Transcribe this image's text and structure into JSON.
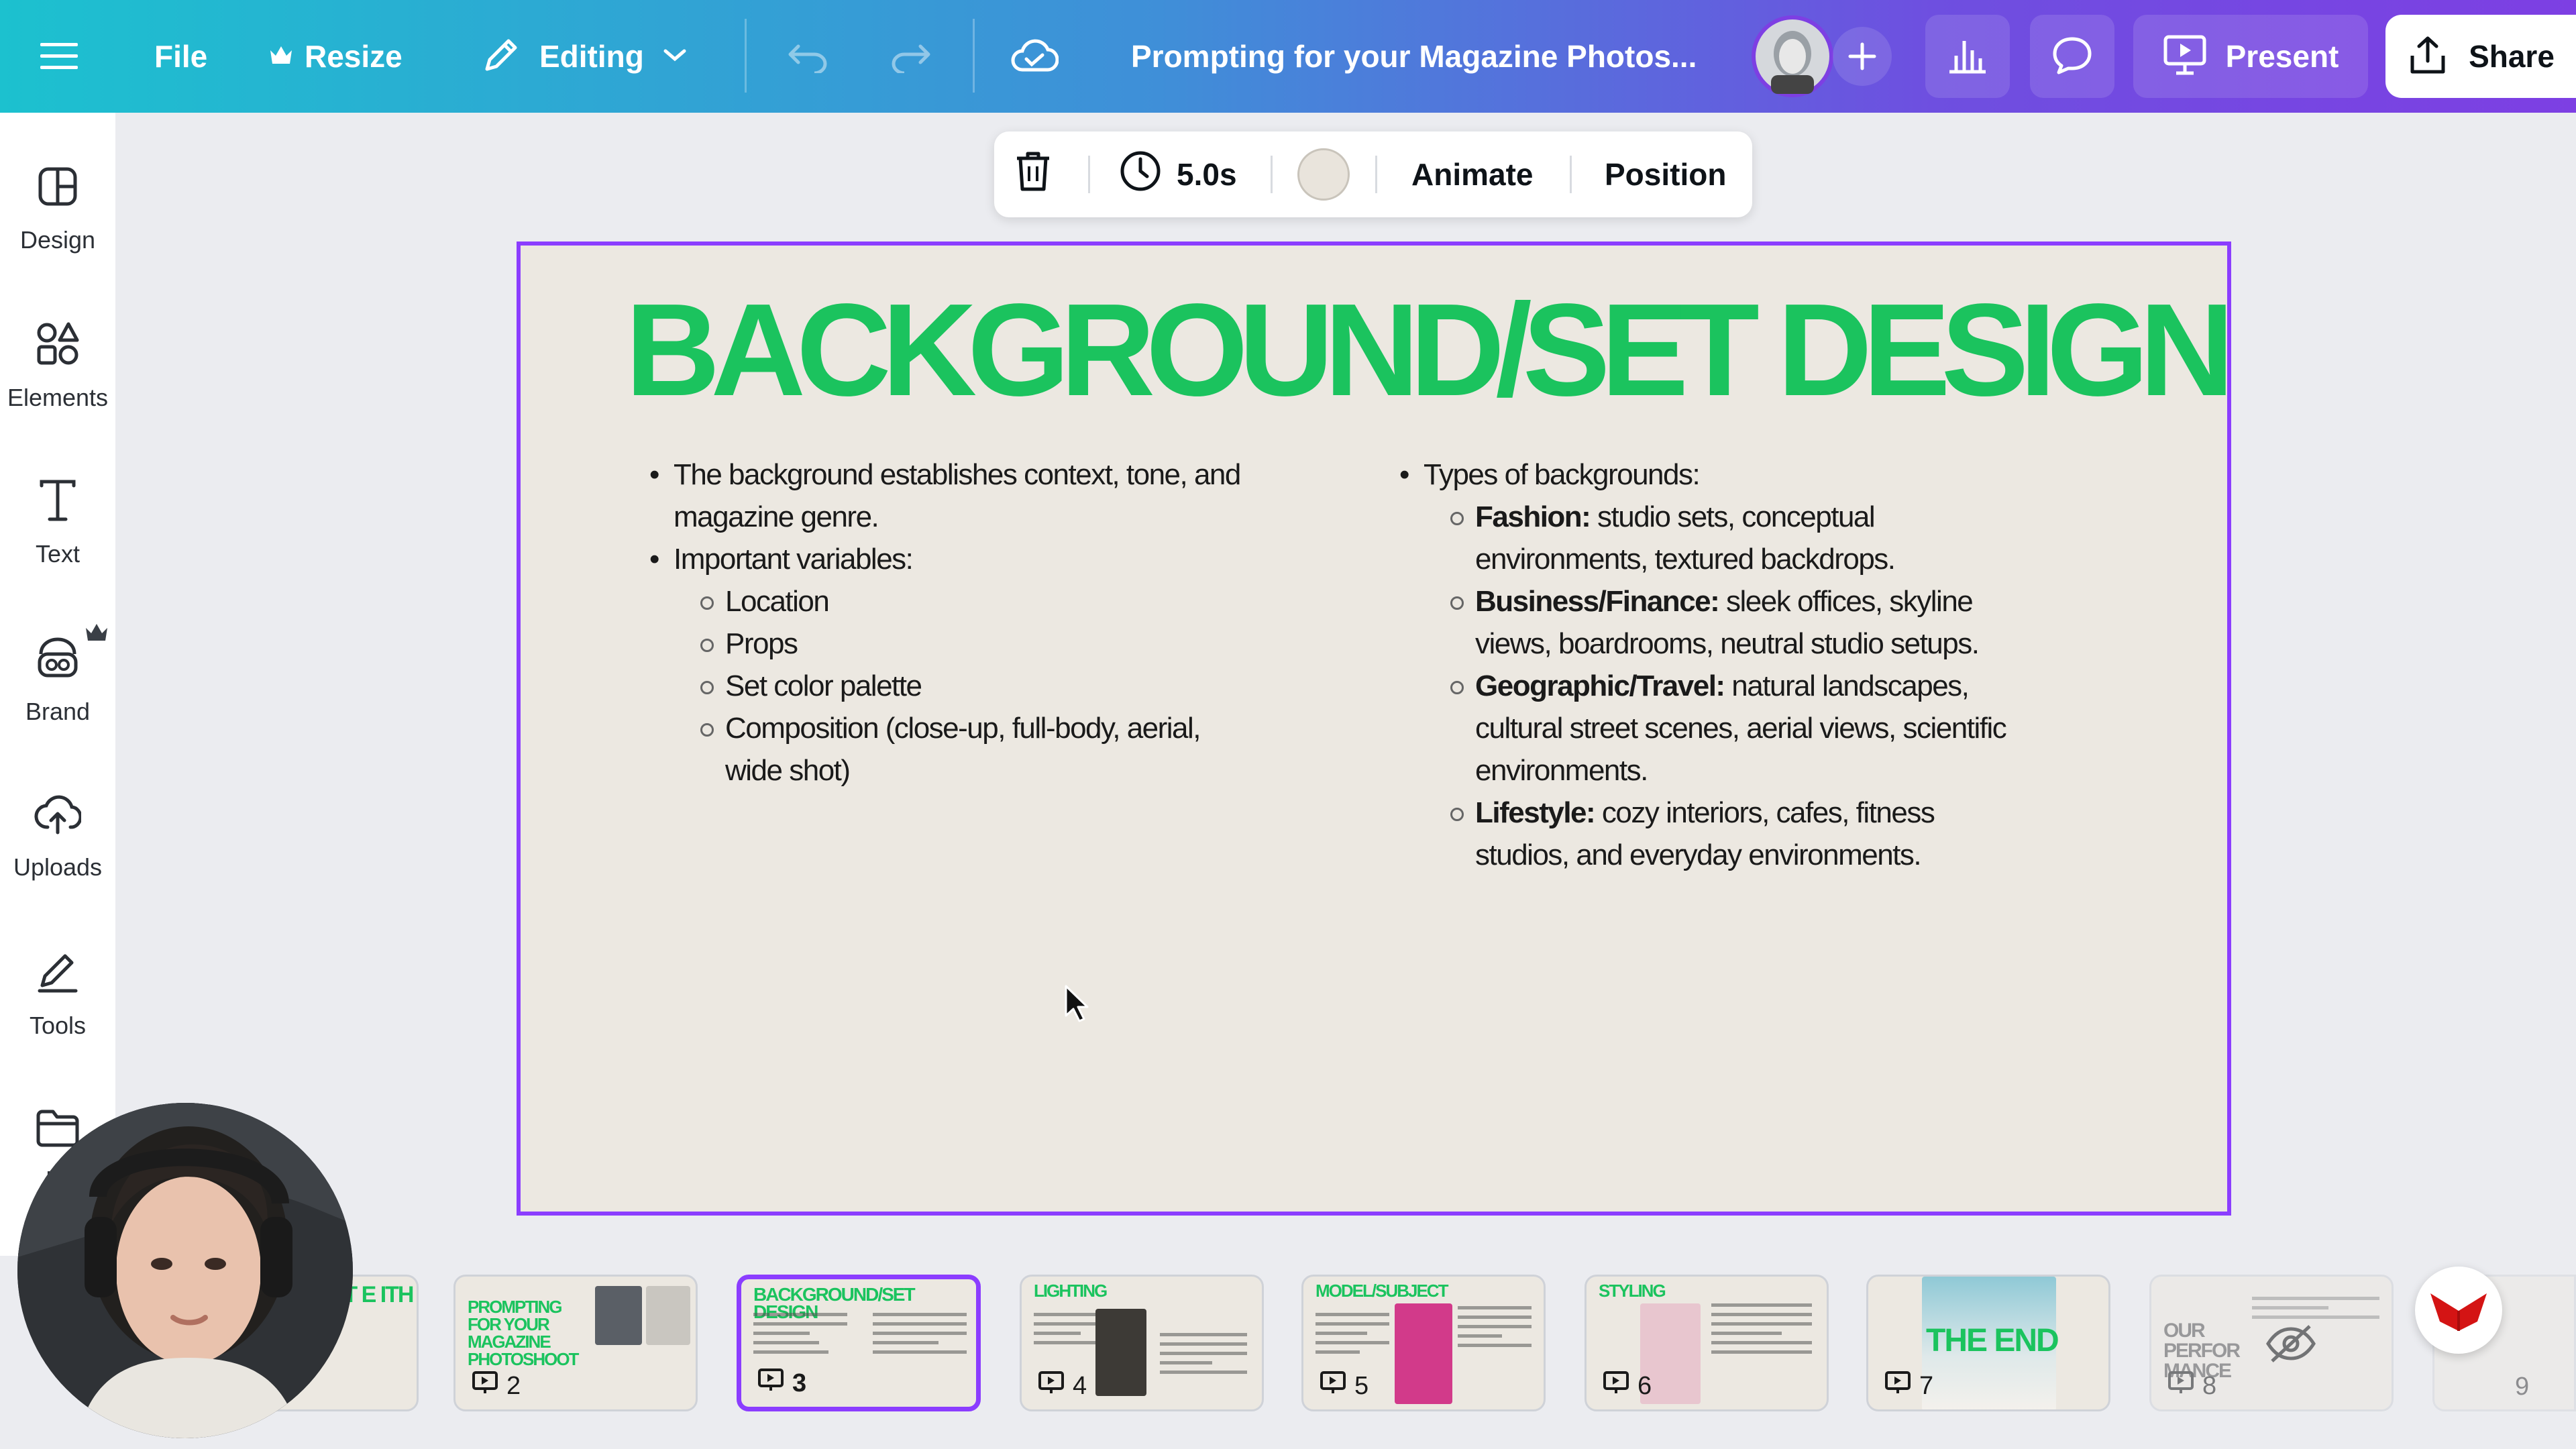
{
  "topbar": {
    "menu_icon": "hamburger-menu-icon",
    "file_label": "File",
    "resize_label": "Resize",
    "editing_label": "Editing",
    "document_title": "Prompting for your Magazine Photos...",
    "present_label": "Present",
    "share_label": "Share"
  },
  "sidebar": {
    "items": [
      {
        "label": "Design",
        "icon": "design-icon"
      },
      {
        "label": "Elements",
        "icon": "elements-icon"
      },
      {
        "label": "Text",
        "icon": "text-icon"
      },
      {
        "label": "Brand",
        "icon": "brand-icon"
      },
      {
        "label": "Uploads",
        "icon": "uploads-icon"
      },
      {
        "label": "Tools",
        "icon": "tools-icon"
      },
      {
        "label": "Pr",
        "icon": "projects-icon"
      }
    ]
  },
  "context_toolbar": {
    "duration": "5.0s",
    "animate_label": "Animate",
    "position_label": "Position",
    "swatch_color": "#e9e4dc"
  },
  "slide": {
    "title": "BACKGROUND/SET DESIGN",
    "left_column": {
      "bullet1": "The background establishes context, tone, and magazine genre.",
      "bullet2": "Important variables:",
      "sub_items": [
        "Location",
        "Props",
        "Set color palette",
        "Composition (close-up, full-body, aerial, wide shot)"
      ]
    },
    "right_column": {
      "bullet1": "Types of backgrounds:",
      "sub_items": [
        {
          "bold": "Fashion:",
          "text": " studio sets, conceptual environments, textured backdrops."
        },
        {
          "bold": "Business/Finance:",
          "text": " sleek offices, skyline views, boardrooms, neutral studio setups."
        },
        {
          "bold": "Geographic/Travel:",
          "text": " natural landscapes, cultural street scenes, aerial views, scientific environments."
        },
        {
          "bold": "Lifestyle:",
          "text": " cozy interiors, cafes, fitness studios, and everyday environments."
        }
      ]
    }
  },
  "pages": [
    {
      "title": "EPT E ITH AI",
      "number": ""
    },
    {
      "title": "PROMPTING FOR YOUR MAGAZINE PHOTOSHOOT",
      "number": "2"
    },
    {
      "title": "BACKGROUND/SET DESIGN",
      "number": "3"
    },
    {
      "title": "LIGHTING",
      "number": "4"
    },
    {
      "title": "MODEL/SUBJECT",
      "number": "5"
    },
    {
      "title": "STYLING",
      "number": "6"
    },
    {
      "title": "THE END",
      "number": "7"
    },
    {
      "title": "OUR PERFOR MANCE",
      "number": "8"
    },
    {
      "title": "",
      "number": "9"
    }
  ],
  "colors": {
    "accent": "#8b3dff",
    "title_green": "#1bc35e",
    "slide_bg": "#ece8e1"
  }
}
